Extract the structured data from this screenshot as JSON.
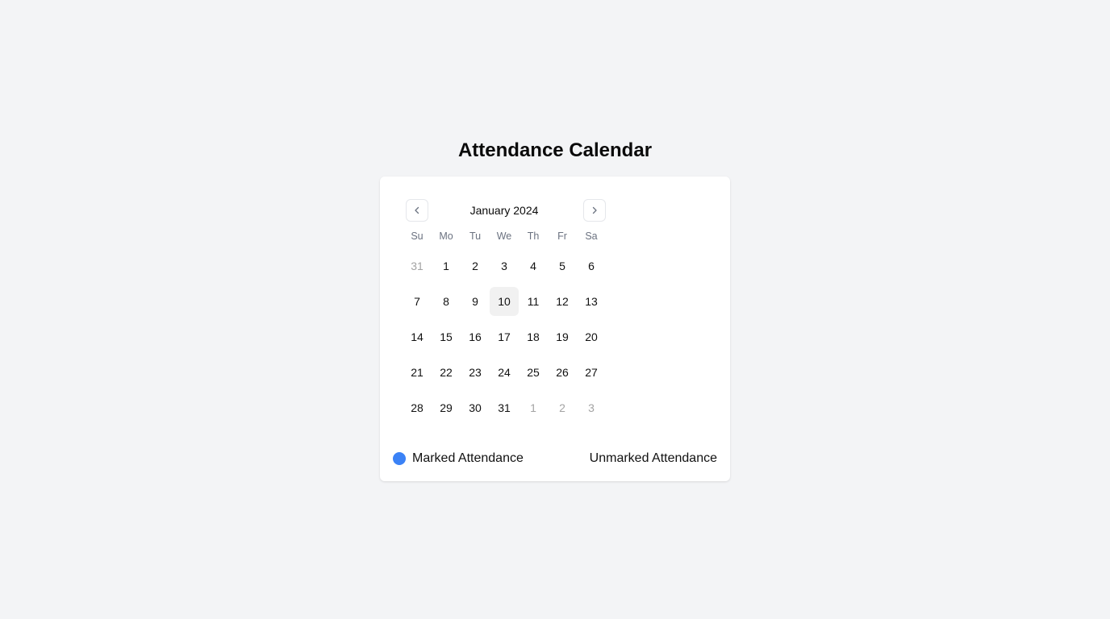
{
  "page": {
    "title": "Attendance Calendar"
  },
  "calendar": {
    "month_label": "January 2024",
    "prev_icon": "chevron-left-icon",
    "next_icon": "chevron-right-icon",
    "weekdays": [
      "Su",
      "Mo",
      "Tu",
      "We",
      "Th",
      "Fr",
      "Sa"
    ],
    "days": [
      {
        "label": "31",
        "outside": true
      },
      {
        "label": "1"
      },
      {
        "label": "2"
      },
      {
        "label": "3"
      },
      {
        "label": "4"
      },
      {
        "label": "5"
      },
      {
        "label": "6"
      },
      {
        "label": "7"
      },
      {
        "label": "8"
      },
      {
        "label": "9"
      },
      {
        "label": "10",
        "today": true
      },
      {
        "label": "11"
      },
      {
        "label": "12"
      },
      {
        "label": "13"
      },
      {
        "label": "14"
      },
      {
        "label": "15"
      },
      {
        "label": "16"
      },
      {
        "label": "17"
      },
      {
        "label": "18"
      },
      {
        "label": "19"
      },
      {
        "label": "20"
      },
      {
        "label": "21"
      },
      {
        "label": "22"
      },
      {
        "label": "23"
      },
      {
        "label": "24"
      },
      {
        "label": "25"
      },
      {
        "label": "26"
      },
      {
        "label": "27"
      },
      {
        "label": "28"
      },
      {
        "label": "29"
      },
      {
        "label": "30"
      },
      {
        "label": "31"
      },
      {
        "label": "1",
        "outside": true
      },
      {
        "label": "2",
        "outside": true
      },
      {
        "label": "3",
        "outside": true
      }
    ]
  },
  "legend": {
    "marked_label": "Marked Attendance",
    "marked_color": "#3b82f6",
    "unmarked_label": "Unmarked Attendance"
  }
}
